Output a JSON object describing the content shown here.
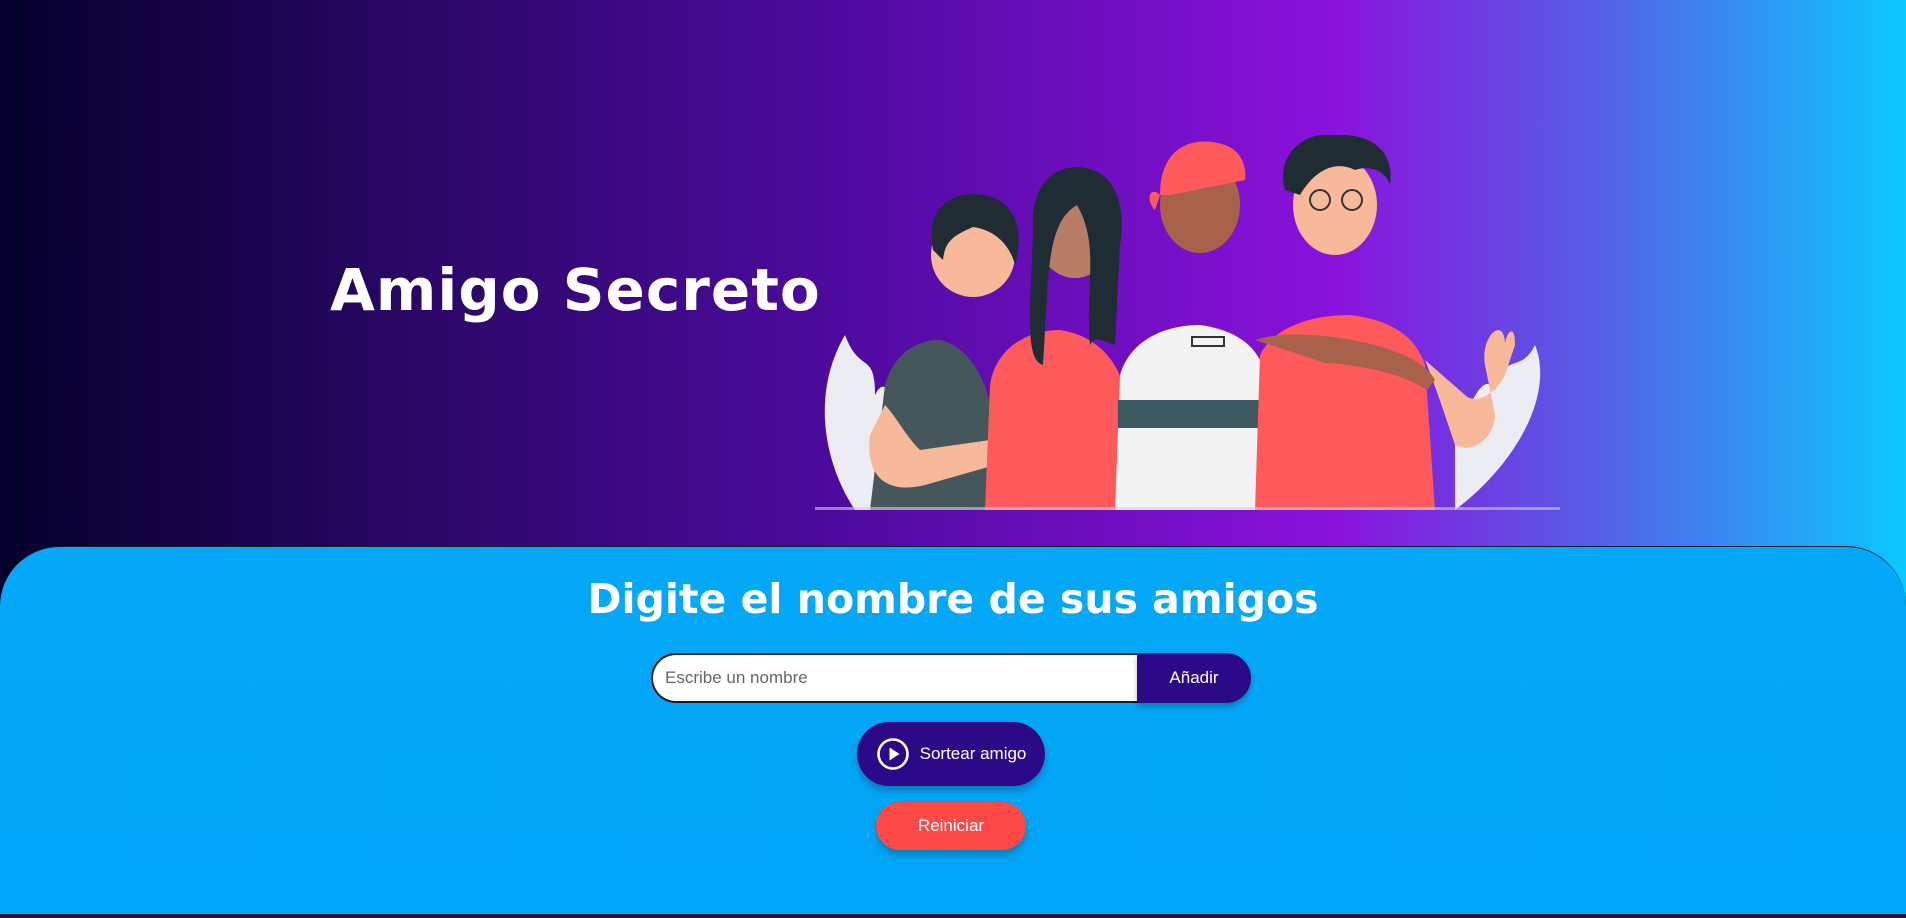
{
  "hero": {
    "title": "Amigo Secreto",
    "illustration_icon": "group-of-friends-illustration"
  },
  "form": {
    "heading": "Digite el nombre de sus amigos",
    "input_placeholder": "Escribe un nombre",
    "input_value": "",
    "add_label": "Añadir",
    "draw_label": "Sortear amigo",
    "draw_icon": "play-circle-icon",
    "reset_label": "Reiniciar"
  },
  "colors": {
    "panel_bg": "#02a6f8",
    "primary_button": "#2c0a87",
    "reset_button": "#fe4a46",
    "text": "#ffffff"
  }
}
